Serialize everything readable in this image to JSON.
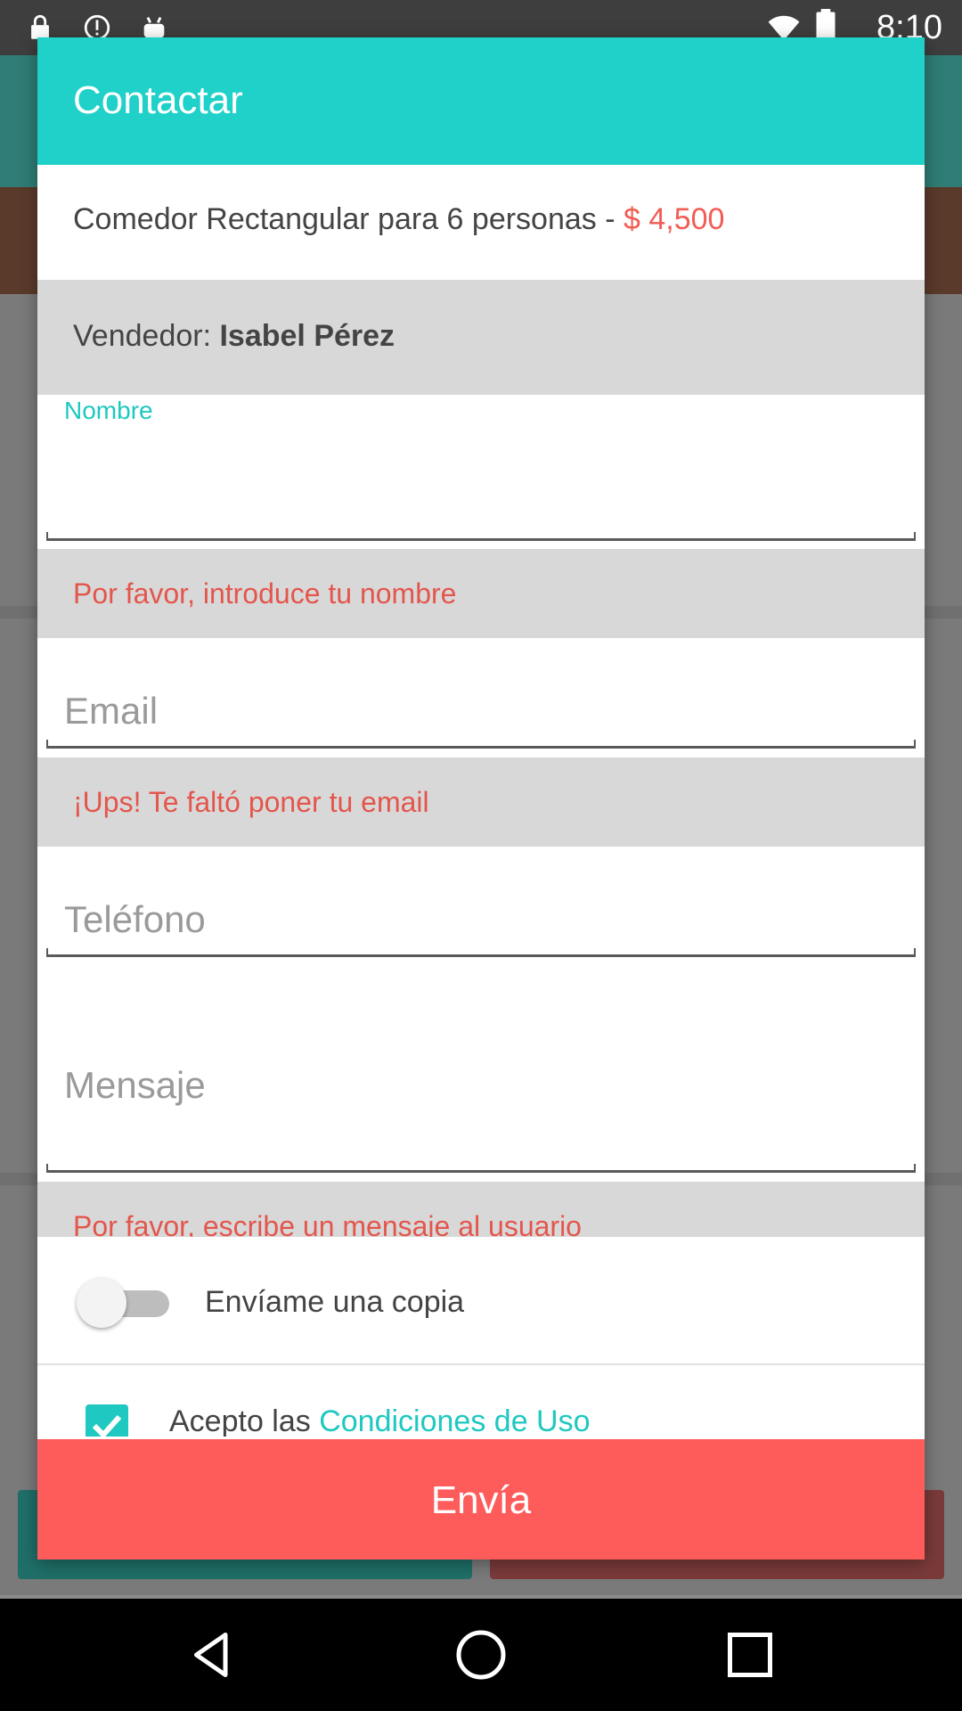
{
  "status_bar": {
    "time": "8:10",
    "icons": [
      "lock-icon",
      "alert-circle-icon",
      "android-icon",
      "wifi-icon",
      "battery-icon"
    ]
  },
  "dialog": {
    "title": "Contactar",
    "product": {
      "name": "Comedor Rectangular para 6 personas - ",
      "price": "$ 4,500"
    },
    "seller": {
      "label": "Vendedor: ",
      "name": "Isabel Pérez"
    },
    "fields": {
      "nombre": {
        "label": "Nombre",
        "value": ""
      },
      "email": {
        "placeholder": "Email"
      },
      "telefono": {
        "placeholder": "Teléfono"
      },
      "mensaje": {
        "placeholder": "Mensaje"
      }
    },
    "errors": {
      "nombre": "Por favor, introduce tu nombre",
      "email": "¡Ups! Te faltó poner tu email",
      "mensaje": "Por favor, escribe un mensaje al usuario"
    },
    "copy_toggle": {
      "label": "Envíame una copia",
      "on": false
    },
    "terms": {
      "prefix": "Acepto las ",
      "link": "Condiciones de Uso",
      "checked": true
    },
    "send_button": "Envía"
  },
  "colors": {
    "accent": "#1fd1c9",
    "error": "#e3564c",
    "send": "#fe5b5b",
    "error_bg": "#d9d8d8"
  },
  "navbar": {
    "icons": [
      "back-icon",
      "home-icon",
      "recents-icon"
    ]
  }
}
